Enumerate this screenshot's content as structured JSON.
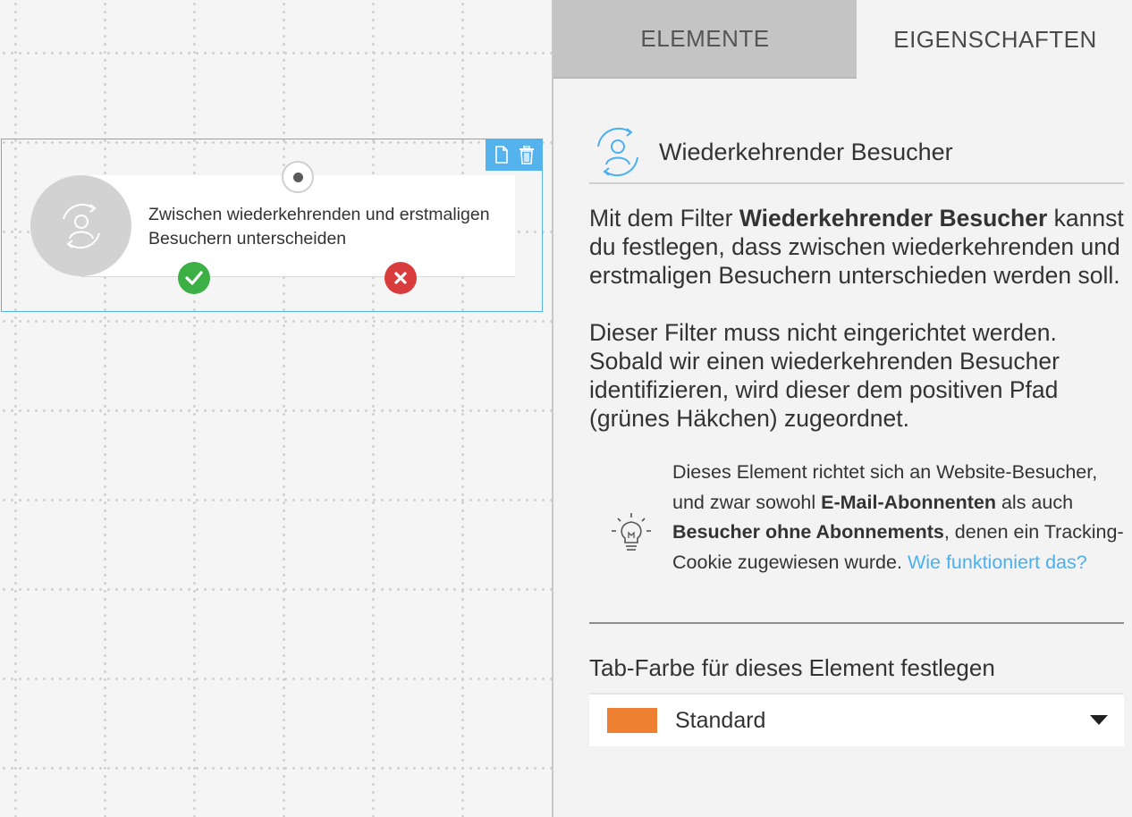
{
  "canvas": {
    "node": {
      "label": "Zwischen wiederkehrenden und erstmaligen Besuchern unterscheiden"
    },
    "toolbar": {
      "copy_icon": "document-icon",
      "delete_icon": "trash-icon"
    }
  },
  "panel": {
    "tabs": [
      {
        "label": "ELEMENTE"
      },
      {
        "label": "EIGENSCHAFTEN"
      }
    ],
    "header": {
      "icon": "returning-visitor-icon",
      "title": "Wiederkehrender Besucher"
    },
    "description": {
      "p1_prefix": "Mit dem Filter ",
      "p1_bold": "Wiederkehrender Besucher",
      "p1_suffix": " kannst du festlegen, dass zwischen wiederkehrenden und erstmaligen Besuchern unterschieden werden soll.",
      "p2": "Dieser Filter muss nicht eingerichtet werden. Sobald wir einen wiederkehrenden Besucher identifizieren, wird dieser dem positiven Pfad (grünes Häkchen) zugeordnet."
    },
    "tip": {
      "icon": "lightbulb-icon",
      "t1": "Dieses Element richtet sich an Website-Besucher, und zwar sowohl ",
      "b1": "E-Mail-Abonnenten",
      "t2": " als auch ",
      "b2": "Besucher ohne Abonnements",
      "t3": ", denen ein Tracking-Cookie zugewiesen wurde. ",
      "link": "Wie funktioniert das?"
    },
    "tab_color": {
      "label": "Tab-Farbe für dieses Element festlegen",
      "selected": "Standard",
      "swatch_color": "#ee8032"
    }
  },
  "colors": {
    "accent": "#54b3ec",
    "yes": "#3cb045",
    "no": "#d93c3c",
    "link": "#4ab0ef"
  }
}
